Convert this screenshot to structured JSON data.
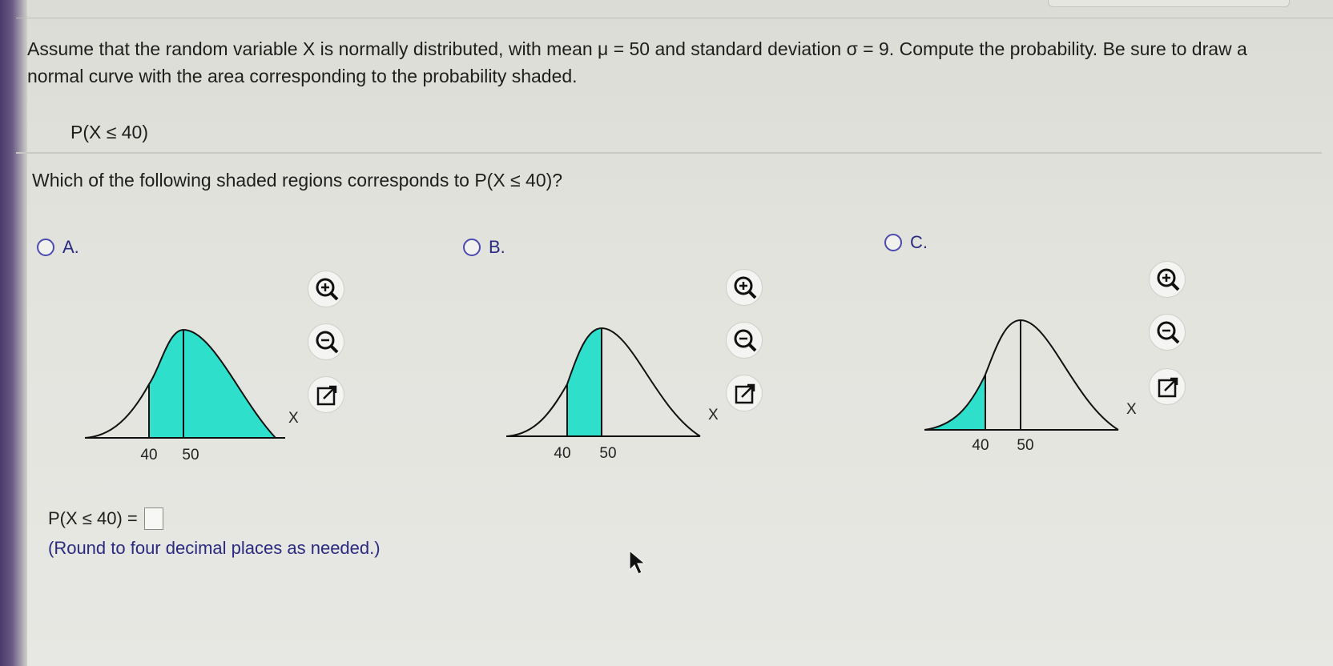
{
  "problem": {
    "statement": "Assume that the random variable X is normally distributed, with mean μ = 50 and standard deviation σ = 9. Compute the probability. Be sure to draw a normal curve with the area corresponding to the probability shaded.",
    "expression": "P(X ≤ 40)"
  },
  "question": "Which of the following shaded regions corresponds to P(X ≤ 40)?",
  "options": [
    {
      "label": "A.",
      "tick_1": "40",
      "tick_2": "50",
      "axis_label": "X",
      "shading": "x ≥ 40"
    },
    {
      "label": "B.",
      "tick_1": "40",
      "tick_2": "50",
      "axis_label": "X",
      "shading": "40 ≤ x ≤ 50"
    },
    {
      "label": "C.",
      "tick_1": "40",
      "tick_2": "50",
      "axis_label": "X",
      "shading": "x ≤ 40"
    }
  ],
  "tools": {
    "zoom_in": "zoom-in-icon",
    "zoom_out": "zoom-out-icon",
    "popout": "popout-icon"
  },
  "answer": {
    "prompt": "P(X ≤ 40) =",
    "value": "",
    "note": "(Round to four decimal places as needed.)"
  },
  "colors": {
    "shade": "#2ee0cc",
    "radio_border": "#4a4ab0",
    "option_text": "#2a2a80"
  }
}
